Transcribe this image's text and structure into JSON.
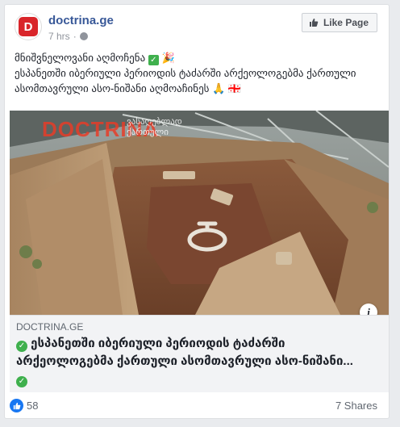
{
  "header": {
    "avatar_letter": "D",
    "page_name": "doctrina.ge",
    "time": "7 hrs",
    "dot": "·",
    "like_page_label": "Like Page"
  },
  "post": {
    "line1": "მნიშვნელოვანი აღმოჩენა",
    "line1_emoji": "🎉",
    "line2": "ესპანეთში იბერიული პერიოდის ტაძარში არქეოლოგებმა ქართული",
    "line3": "ასომთავრული ასო-ნიშანი აღმოაჩინეს",
    "line3_emojis": "🙏 🇬🇪"
  },
  "photo": {
    "watermark": "DOCTRINA",
    "watermark_sub_1": "ვასაღებლად",
    "watermark_sub_2": "ქართული"
  },
  "link": {
    "domain": "DOCTRINA.GE",
    "title_line1": "ესპანეთში იბერიული პერიოდის ტაძარში",
    "title_line2": "არქეოლოგებმა ქართული ასომთავრული ასო-ნიშანი...",
    "info_glyph": "i"
  },
  "footer": {
    "like_count": "58",
    "shares": "7 Shares"
  },
  "colors": {
    "link_blue": "#385898",
    "accent_green": "#3fb04d",
    "like_blue": "#1877f2",
    "logo_red": "#d9252a"
  }
}
